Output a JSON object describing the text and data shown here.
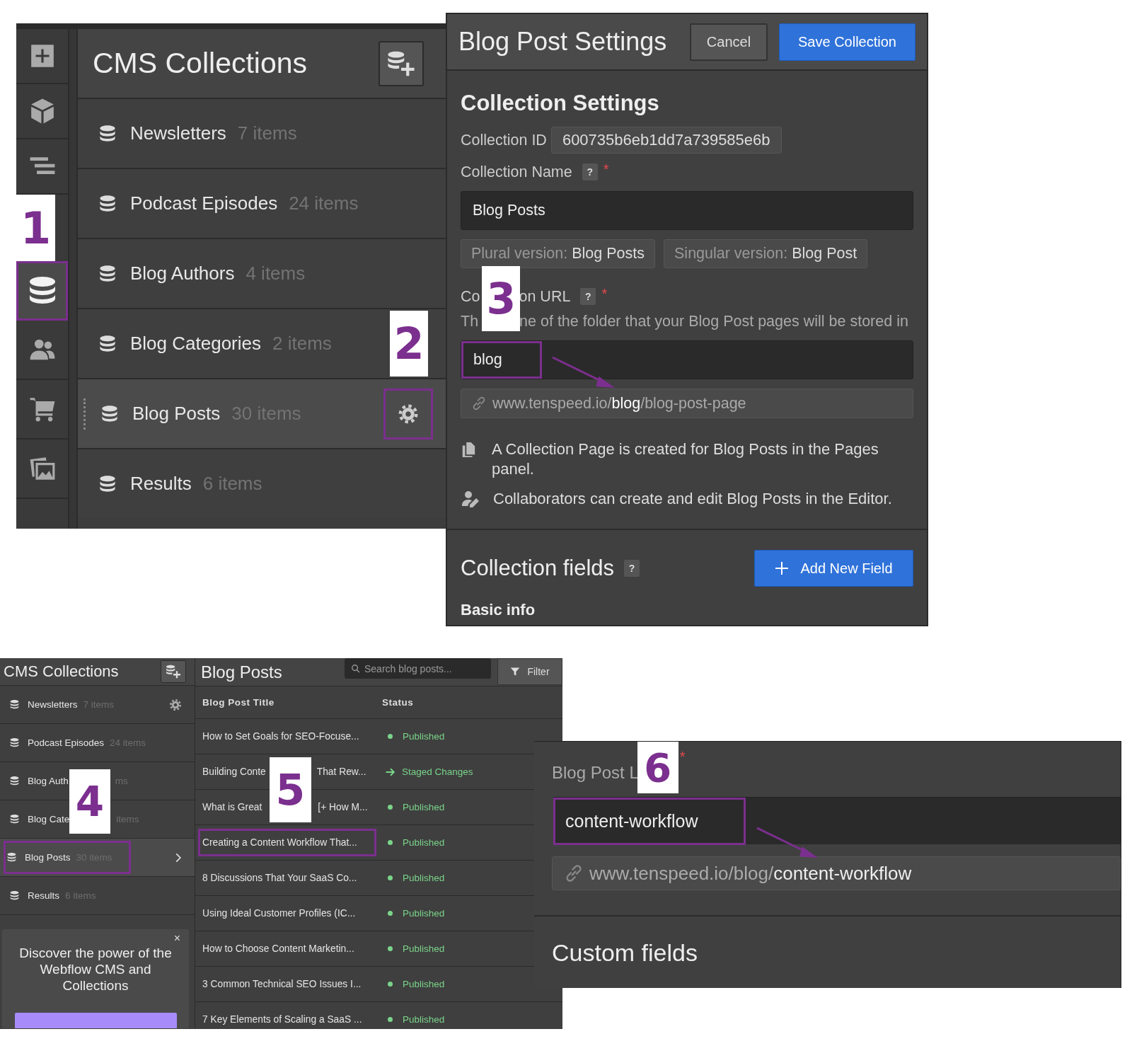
{
  "cms_sidebar": {
    "rail": [
      {
        "kind": "add",
        "selected": false,
        "highlighted": false
      },
      {
        "kind": "objects",
        "selected": false,
        "highlighted": false
      },
      {
        "kind": "navigator",
        "selected": false,
        "highlighted": false
      },
      {
        "kind": "callout",
        "label": "1"
      },
      {
        "kind": "database",
        "selected": true,
        "highlighted": true
      },
      {
        "kind": "users",
        "selected": false,
        "highlighted": false
      },
      {
        "kind": "ecommerce",
        "selected": false,
        "highlighted": false
      },
      {
        "kind": "assets",
        "selected": false,
        "highlighted": false
      }
    ],
    "title": "CMS Collections",
    "collections": [
      {
        "name": "Newsletters",
        "count": "7 items",
        "selected": false
      },
      {
        "name": "Podcast Episodes",
        "count": "24 items",
        "selected": false
      },
      {
        "name": "Blog Authors",
        "count": "4 items",
        "selected": false
      },
      {
        "name": "Blog Categories",
        "count": "2 items",
        "selected": false,
        "callout": "2"
      },
      {
        "name": "Blog Posts",
        "count": "30 items",
        "selected": true,
        "settings_highlighted": true
      },
      {
        "name": "Results",
        "count": "6 items",
        "selected": false
      }
    ]
  },
  "settings": {
    "title": "Blog Post Settings",
    "cancel": "Cancel",
    "save": "Save Collection",
    "section_title": "Collection Settings",
    "id_label": "Collection ID",
    "id_value": "600735b6eb1dd7a739585e6b",
    "name_label": "Collection Name",
    "name_help": "?",
    "name_required": "*",
    "name_value": "Blog Posts",
    "plural_label": "Plural version:",
    "plural_value": "Blog Posts",
    "singular_label": "Singular version:",
    "singular_value": "Blog Post",
    "url_label_before": "Co",
    "callout": "3",
    "url_label_after": "on URL",
    "url_help_mark": "?",
    "url_required": "*",
    "url_help_before": "Th",
    "url_help_after": "ne of the folder that your Blog Post pages will be stored in",
    "url_value": "blog",
    "url_highlighted": true,
    "url_preview": "www.tenspeed.io/**blog**/blog-post-page",
    "info": [
      {
        "kind": "pages",
        "text": "A Collection Page is created for Blog Posts in the Pages panel."
      },
      {
        "kind": "editor",
        "text": "Collaborators can create and edit Blog Posts in the Editor."
      }
    ],
    "fields_title": "Collection fields",
    "fields_help": "?",
    "add_field": "Add New Field",
    "basic_info": "Basic info"
  },
  "collections_panel": {
    "title": "CMS Collections",
    "collections": [
      {
        "name": "Newsletters",
        "count": "7 items",
        "selected": false,
        "hovered": true,
        "highlighted": false
      },
      {
        "name": "Podcast Episodes",
        "count": "24 items",
        "selected": false,
        "hovered": false,
        "highlighted": false
      },
      {
        "name": "Blog Auth",
        "callout": "4",
        "count": "ms",
        "selected": false,
        "hovered": false,
        "highlighted": false
      },
      {
        "name": "Blog Cate",
        "covered": true,
        "count": "items",
        "selected": false,
        "hovered": false,
        "highlighted": false
      },
      {
        "name": "Blog Posts",
        "count": "30 items",
        "selected": true,
        "hovered": false,
        "highlighted": true
      },
      {
        "name": "Results",
        "count": "6 items",
        "selected": false,
        "hovered": false,
        "highlighted": false
      }
    ],
    "promo": {
      "close": "×",
      "text": "Discover the power of the Webflow CMS and Collections"
    }
  },
  "posts_table": {
    "title": "Blog Posts",
    "search_placeholder": "Search blog posts...",
    "filter": "Filter",
    "columns": [
      "Blog Post Title",
      "Status"
    ],
    "rows": [
      {
        "title": "How to Set Goals for SEO-Focuse...",
        "status": "Published",
        "kind": "published",
        "highlighted": false
      },
      {
        "title": "Building Conte",
        "callout": "5",
        "title_after": "That Rew...",
        "status": "Staged Changes",
        "kind": "staged",
        "highlighted": false
      },
      {
        "title": "What is Great",
        "covered": true,
        "title_after": "[+ How M...",
        "status": "Published",
        "kind": "published",
        "highlighted": false
      },
      {
        "title": "Creating a Content Workflow That...",
        "status": "Published",
        "kind": "published",
        "highlighted": true
      },
      {
        "title": "8 Discussions That Your SaaS Co...",
        "status": "Published",
        "kind": "published",
        "highlighted": false
      },
      {
        "title": "Using Ideal Customer Profiles (IC...",
        "status": "Published",
        "kind": "published",
        "highlighted": false
      },
      {
        "title": "How to Choose Content Marketin...",
        "status": "Published",
        "kind": "published",
        "highlighted": false
      },
      {
        "title": "3 Common Technical SEO Issues I...",
        "status": "Published",
        "kind": "published",
        "highlighted": false
      },
      {
        "title": "7 Key Elements of Scaling a SaaS ...",
        "status": "Published",
        "kind": "published",
        "highlighted": false
      }
    ]
  },
  "slug_panel": {
    "label": "Blog Post L",
    "callout": "6",
    "required": "*",
    "value": "content-workflow",
    "highlighted": true,
    "preview": "www.tenspeed.io/blog/**content-workflow**",
    "custom_title": "Custom fields"
  }
}
